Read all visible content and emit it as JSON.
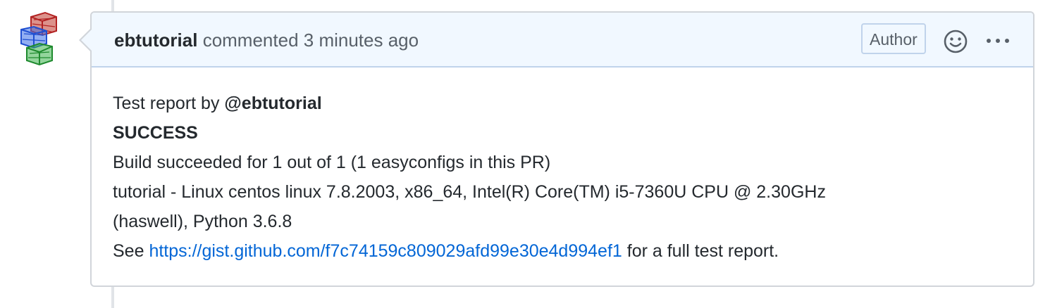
{
  "comment": {
    "author": "ebtutorial",
    "action": "commented",
    "timestamp": "3 minutes ago",
    "badge": "Author",
    "reaction_icon": "smiley-icon",
    "menu_icon": "kebab-horizontal-icon",
    "body": {
      "line1_prefix": "Test report by ",
      "line1_mention": "@ebtutorial",
      "line2": "SUCCESS",
      "line3": "Build succeeded for 1 out of 1 (1 easyconfigs in this PR)",
      "line4": "tutorial - Linux centos linux 7.8.2003, x86_64, Intel(R) Core(TM) i5-7360U CPU @ 2.30GHz",
      "line5": "(haswell), Python 3.6.8",
      "line6_prefix": "See ",
      "line6_link": "https://gist.github.com/f7c74159c809029afd99e30e4d994ef1",
      "line6_suffix": " for a full test report."
    }
  },
  "colors": {
    "header_bg": "#f1f8ff",
    "header_border": "#c0d3eb",
    "box_border": "#d1d5da",
    "link": "#0366d6",
    "muted_text": "#586069",
    "text": "#24292e"
  }
}
